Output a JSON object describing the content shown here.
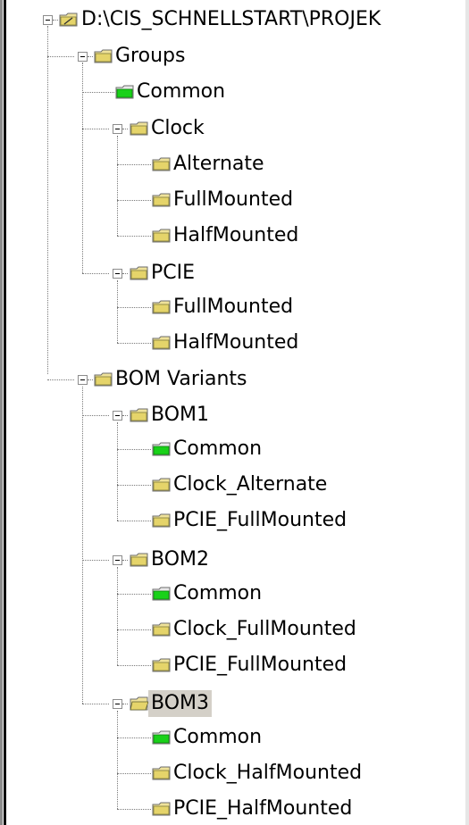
{
  "tree": {
    "root": {
      "label": "D:\\CIS_SCHNELLSTART\\PROJEK"
    },
    "groups": {
      "label": "Groups",
      "common": "Common",
      "clock": {
        "label": "Clock",
        "children": [
          "Alternate",
          "FullMounted",
          "HalfMounted"
        ]
      },
      "pcie": {
        "label": "PCIE",
        "children": [
          "FullMounted",
          "HalfMounted"
        ]
      }
    },
    "bom_variants": {
      "label": "BOM Variants",
      "bom1": {
        "label": "BOM1",
        "children": [
          "Common",
          "Clock_Alternate",
          "PCIE_FullMounted"
        ]
      },
      "bom2": {
        "label": "BOM2",
        "children": [
          "Common",
          "Clock_FullMounted",
          "PCIE_FullMounted"
        ]
      },
      "bom3": {
        "label": "BOM3",
        "children": [
          "Common",
          "Clock_HalfMounted",
          "PCIE_HalfMounted"
        ]
      }
    }
  },
  "colors": {
    "folder_yellow": "#e8d878",
    "folder_green": "#1fd31f",
    "selection_bg": "#d4d0c8"
  }
}
